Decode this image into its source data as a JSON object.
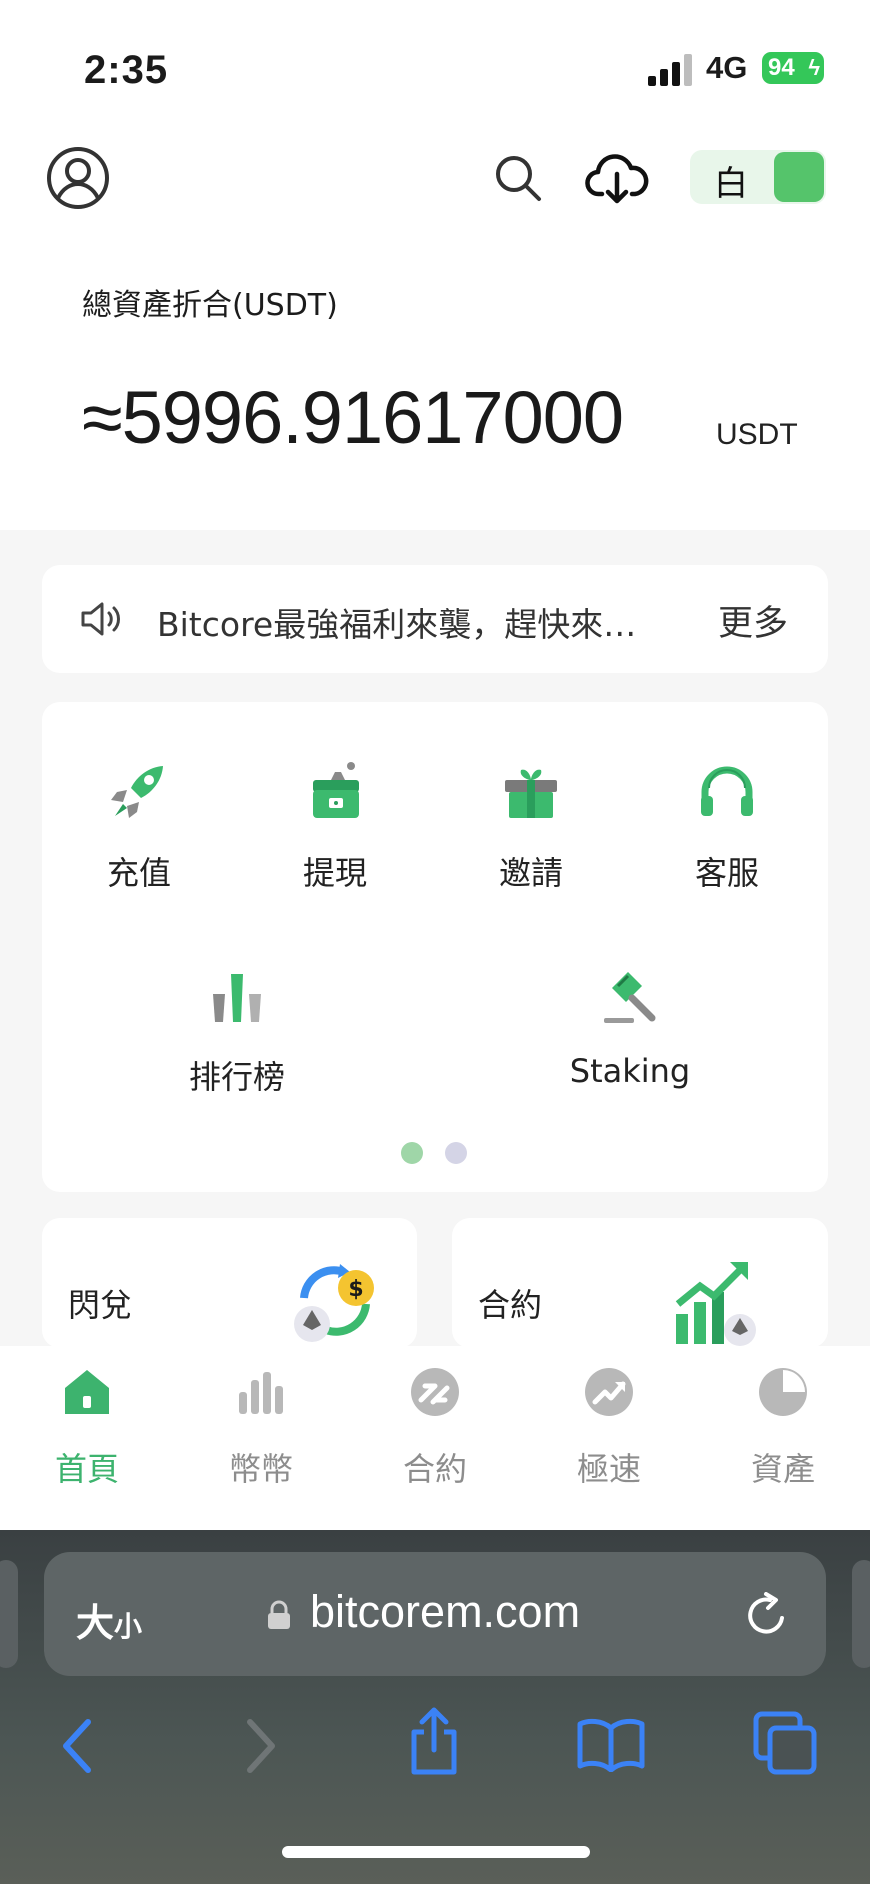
{
  "status_bar": {
    "time": "2:35",
    "network": "4G",
    "battery": "94"
  },
  "header": {
    "theme_toggle_label": "白"
  },
  "assets": {
    "label": "總資產折合(USDT)",
    "value": "≈5996.91617000",
    "unit": "USDT"
  },
  "notice": {
    "text": "Bitcore最強福利來襲，趕快來…",
    "more": "更多"
  },
  "quick_actions": [
    {
      "label": "充值",
      "icon": "rocket-icon"
    },
    {
      "label": "提現",
      "icon": "withdraw-icon"
    },
    {
      "label": "邀請",
      "icon": "gift-icon"
    },
    {
      "label": "客服",
      "icon": "headphones-icon"
    },
    {
      "label": "排行榜",
      "icon": "ranking-icon"
    },
    {
      "label": "Staking",
      "icon": "hammer-icon"
    }
  ],
  "pager": {
    "active_color": "#9fd6a8",
    "inactive_color": "#d4d4e6"
  },
  "feature_cards": [
    {
      "label": "閃兌",
      "icon": "exchange-icon"
    },
    {
      "label": "合約",
      "icon": "chart-up-icon"
    }
  ],
  "tabs": [
    {
      "label": "首頁",
      "icon": "home-icon",
      "active": true
    },
    {
      "label": "幣幣",
      "icon": "bars-icon"
    },
    {
      "label": "合約",
      "icon": "contract-icon"
    },
    {
      "label": "極速",
      "icon": "trend-icon"
    },
    {
      "label": "資產",
      "icon": "pie-icon"
    }
  ],
  "browser": {
    "text_size": "大",
    "text_size_small": "小",
    "url": "bitcorem.com"
  },
  "colors": {
    "accent": "#3db36e",
    "safari_blue": "#3b82f6"
  }
}
